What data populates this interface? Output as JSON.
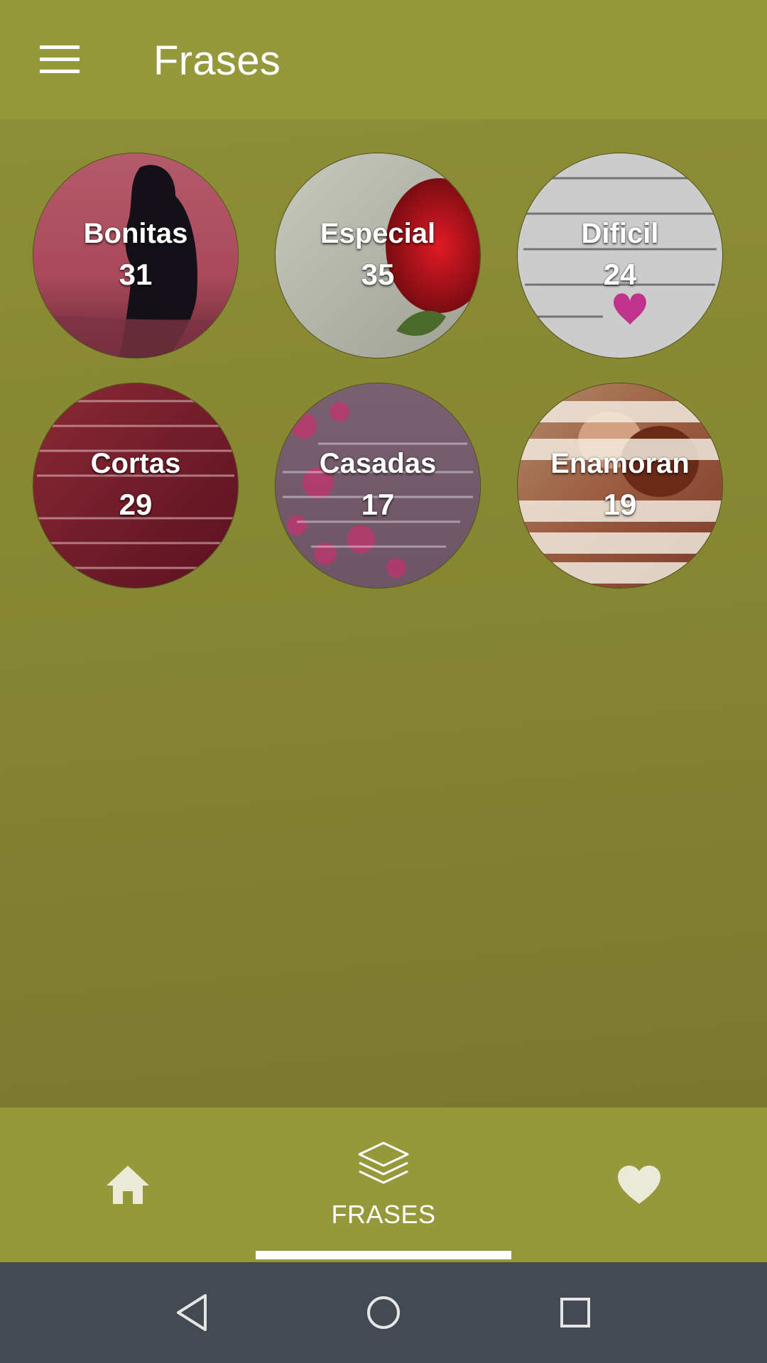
{
  "app": {
    "title": "Frases"
  },
  "appbar": {
    "menu_icon": "hamburger-menu-icon"
  },
  "categories": [
    {
      "name": "Bonitas",
      "count": "31"
    },
    {
      "name": "Especial",
      "count": "35"
    },
    {
      "name": "Dificil",
      "count": "24"
    },
    {
      "name": "Cortas",
      "count": "29"
    },
    {
      "name": "Casadas",
      "count": "17"
    },
    {
      "name": "Enamoran",
      "count": "19"
    }
  ],
  "tabs": [
    {
      "icon": "home-icon",
      "label": ""
    },
    {
      "icon": "layers-icon",
      "label": "FRASES",
      "selected": true
    },
    {
      "icon": "heart-icon",
      "label": ""
    }
  ],
  "navbar": {
    "icons": [
      "back-triangle-icon",
      "home-circle-icon",
      "recents-square-icon"
    ]
  },
  "colors": {
    "appbar": "#95993c",
    "content_bg": "#858631",
    "navbar": "#434a51",
    "text": "#ffffff",
    "tab_indicator": "#ffffff"
  }
}
